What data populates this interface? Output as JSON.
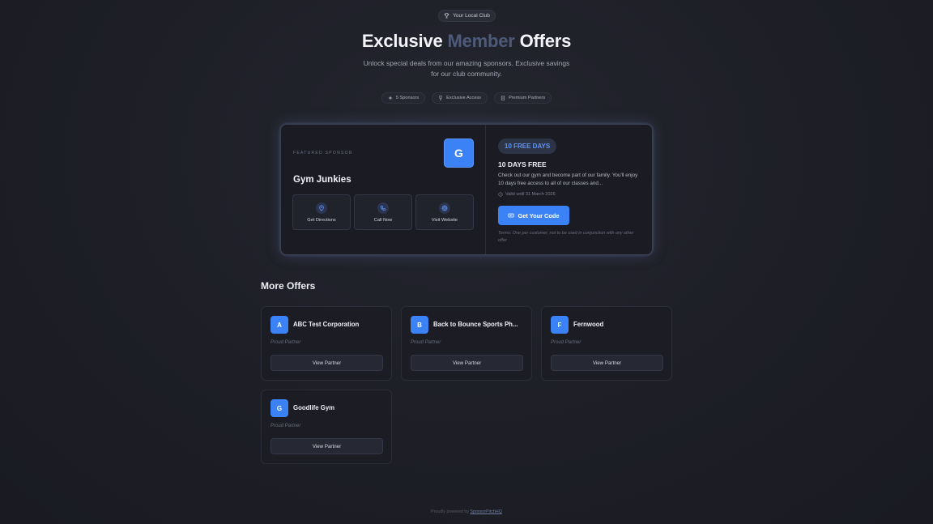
{
  "header": {
    "club_badge": "Your Local Club",
    "title_part1": "Exclusive",
    "title_accent": "Member",
    "title_part2": "Offers",
    "subtitle": "Unlock special deals from our amazing sponsors. Exclusive savings for our club community.",
    "stats": [
      {
        "icon": "sparkle-icon",
        "label": "5 Sponsors"
      },
      {
        "icon": "trophy-icon",
        "label": "Exclusive Access"
      },
      {
        "icon": "building-icon",
        "label": "Premium Partners"
      }
    ]
  },
  "featured": {
    "eyebrow": "FEATURED SPONSOR",
    "logo_letter": "G",
    "name": "Gym Junkies",
    "actions": [
      {
        "icon": "map-pin-icon",
        "label": "Get Directions"
      },
      {
        "icon": "phone-icon",
        "label": "Call Now"
      },
      {
        "icon": "globe-icon",
        "label": "Visit Website"
      }
    ],
    "offer_badge": "10 FREE DAYS",
    "offer_title": "10 DAYS FREE",
    "offer_description": "Check out our gym and become part of our family. You'll enjoy 10 days free access to all of our classes and...",
    "valid_until": "Valid until 31 March 2026",
    "code_button": "Get Your Code",
    "terms": "Terms: One per customer, not to be used in conjunction with any other offer"
  },
  "more_offers": {
    "title": "More Offers",
    "cards": [
      {
        "letter": "A",
        "name": "ABC Test Corporation",
        "tag": "Proud Partner",
        "button": "View Partner"
      },
      {
        "letter": "B",
        "name": "Back to Bounce Sports Ph...",
        "tag": "Proud Partner",
        "button": "View Partner"
      },
      {
        "letter": "F",
        "name": "Fernwood",
        "tag": "Proud Partner",
        "button": "View Partner"
      },
      {
        "letter": "G",
        "name": "Goodlife Gym",
        "tag": "Proud Partner",
        "button": "View Partner"
      }
    ]
  },
  "footer": {
    "prefix": "Proudly powered by",
    "link": "SponsorPitchHQ"
  },
  "colors": {
    "accent": "#3b82f6",
    "background": "#1d1e26",
    "title_accent": "#4e5a7a"
  }
}
